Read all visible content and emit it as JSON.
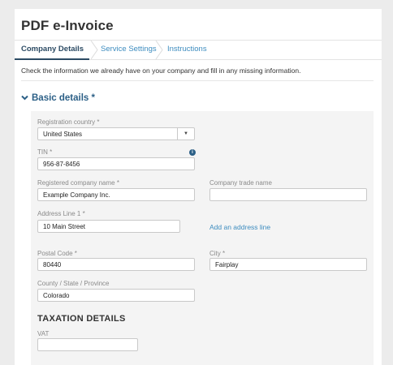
{
  "app": {
    "title": "PDF e-Invoice"
  },
  "tabs": [
    {
      "label": "Company Details",
      "active": true
    },
    {
      "label": "Service Settings",
      "active": false
    },
    {
      "label": "Instructions",
      "active": false
    }
  ],
  "intro": "Check the information we already have on your company and fill in any missing information.",
  "section": {
    "title": "Basic details *",
    "icon": "chevron-down-icon"
  },
  "form": {
    "registration_country": {
      "label": "Registration country *",
      "value": "United States"
    },
    "tin": {
      "label": "TIN *",
      "value": "956-87-8456",
      "icon": "info-icon"
    },
    "registered_name": {
      "label": "Registered company name *",
      "value": "Example Company Inc."
    },
    "trade_name": {
      "label": "Company trade name",
      "value": ""
    },
    "address1": {
      "label": "Address Line 1 *",
      "value": "10 Main Street"
    },
    "add_address_line": "Add an address line",
    "postal_code": {
      "label": "Postal Code *",
      "value": "80440"
    },
    "city": {
      "label": "City *",
      "value": "Fairplay"
    },
    "county": {
      "label": "County / State / Province",
      "value": "Colorado"
    }
  },
  "taxation": {
    "title": "TAXATION DETAILS",
    "vat": {
      "label": "VAT",
      "value": ""
    }
  },
  "colors": {
    "accent": "#2b5f86",
    "link": "#3d8cbf",
    "active_tab": "#2b4a63",
    "panel_bg": "#f4f4f4"
  }
}
